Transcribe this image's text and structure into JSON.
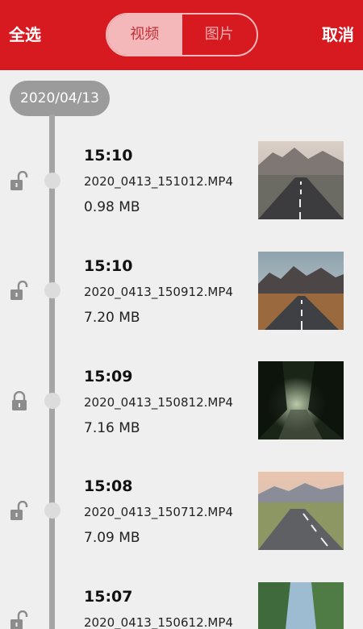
{
  "header": {
    "select_all": "全选",
    "cancel": "取消",
    "tabs": [
      {
        "label": "视频",
        "active": true
      },
      {
        "label": "图片",
        "active": false
      }
    ],
    "accent_color": "#d71920"
  },
  "group": {
    "date": "2020/04/13"
  },
  "items": [
    {
      "time": "15:10",
      "filename": "2020_0413_151012.MP4",
      "size": "0.98 MB",
      "lock_icon": "unlock-icon",
      "thumbnail": "mountain-road"
    },
    {
      "time": "15:10",
      "filename": "2020_0413_150912.MP4",
      "size": "7.20 MB",
      "lock_icon": "unlock-icon",
      "thumbnail": "canyon-road"
    },
    {
      "time": "15:09",
      "filename": "2020_0413_150812.MP4",
      "size": "7.16 MB",
      "lock_icon": "lock-icon",
      "thumbnail": "forest-path"
    },
    {
      "time": "15:08",
      "filename": "2020_0413_150712.MP4",
      "size": "7.09 MB",
      "lock_icon": "unlock-icon",
      "thumbnail": "highway-dusk"
    },
    {
      "time": "15:07",
      "filename": "2020_0413_150612.MP4",
      "size": "",
      "lock_icon": "unlock-icon",
      "thumbnail": "trees-road"
    }
  ]
}
